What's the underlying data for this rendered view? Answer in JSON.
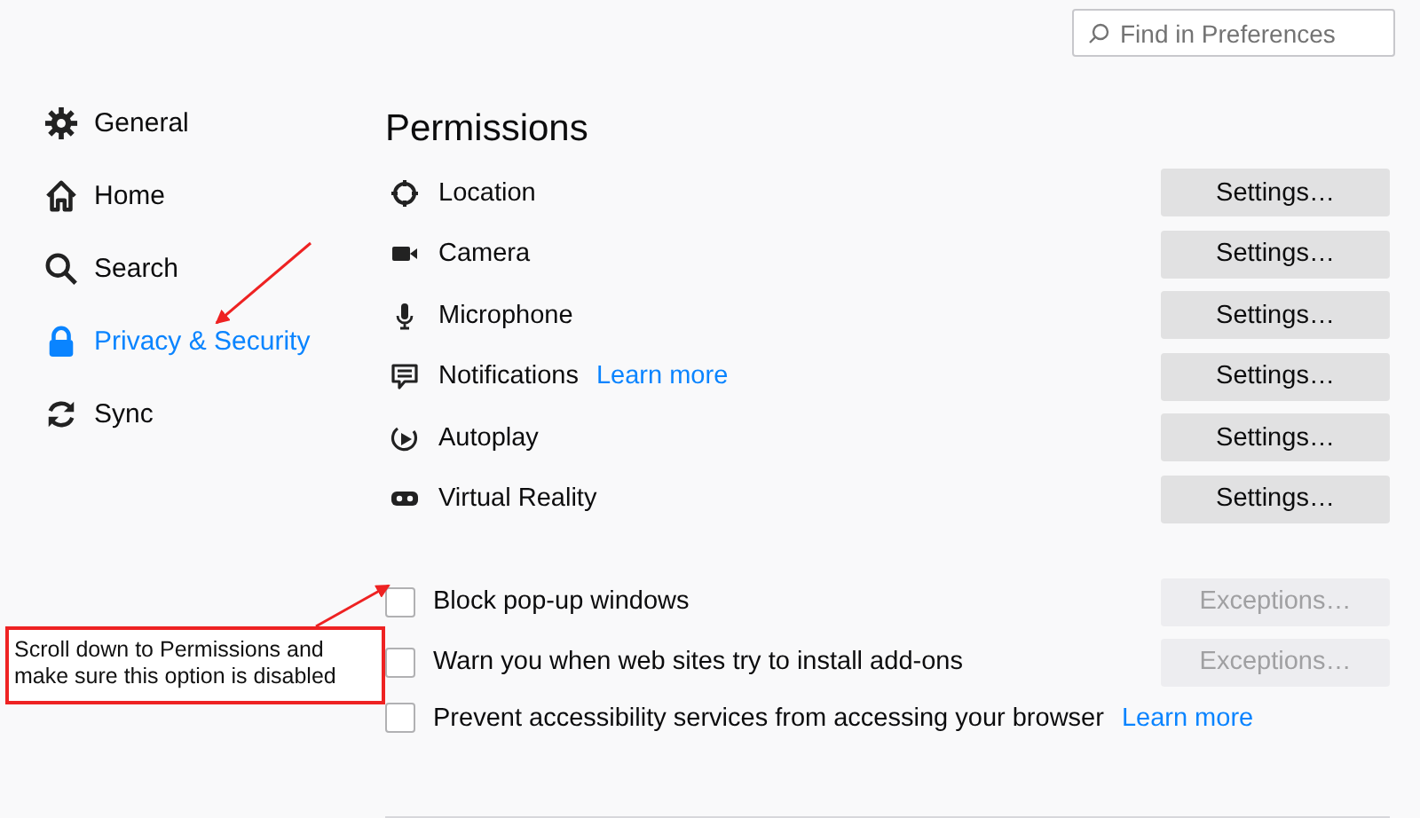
{
  "search": {
    "placeholder": "Find in Preferences"
  },
  "sidebar": {
    "items": [
      {
        "label": "General",
        "selected": false
      },
      {
        "label": "Home",
        "selected": false
      },
      {
        "label": "Search",
        "selected": false
      },
      {
        "label": "Privacy & Security",
        "selected": true
      },
      {
        "label": "Sync",
        "selected": false
      }
    ]
  },
  "permissions": {
    "title": "Permissions",
    "rows": [
      {
        "kind": "location",
        "label": "Location",
        "button": "Settings…"
      },
      {
        "kind": "camera",
        "label": "Camera",
        "button": "Settings…"
      },
      {
        "kind": "microphone",
        "label": "Microphone",
        "button": "Settings…"
      },
      {
        "kind": "notifications",
        "label": "Notifications",
        "link": "Learn more",
        "button": "Settings…"
      },
      {
        "kind": "autoplay",
        "label": "Autoplay",
        "button": "Settings…"
      },
      {
        "kind": "vr",
        "label": "Virtual Reality",
        "button": "Settings…"
      }
    ],
    "options": [
      {
        "label": "Block pop-up windows",
        "checked": false,
        "button": "Exceptions…",
        "button_disabled": true
      },
      {
        "label": "Warn you when web sites try to install add-ons",
        "checked": false,
        "button": "Exceptions…",
        "button_disabled": true
      },
      {
        "label": "Prevent accessibility services from accessing your browser",
        "checked": false,
        "link": "Learn more"
      }
    ]
  },
  "annotation": {
    "text": "Scroll down to Permissions and make sure this option is disabled"
  }
}
